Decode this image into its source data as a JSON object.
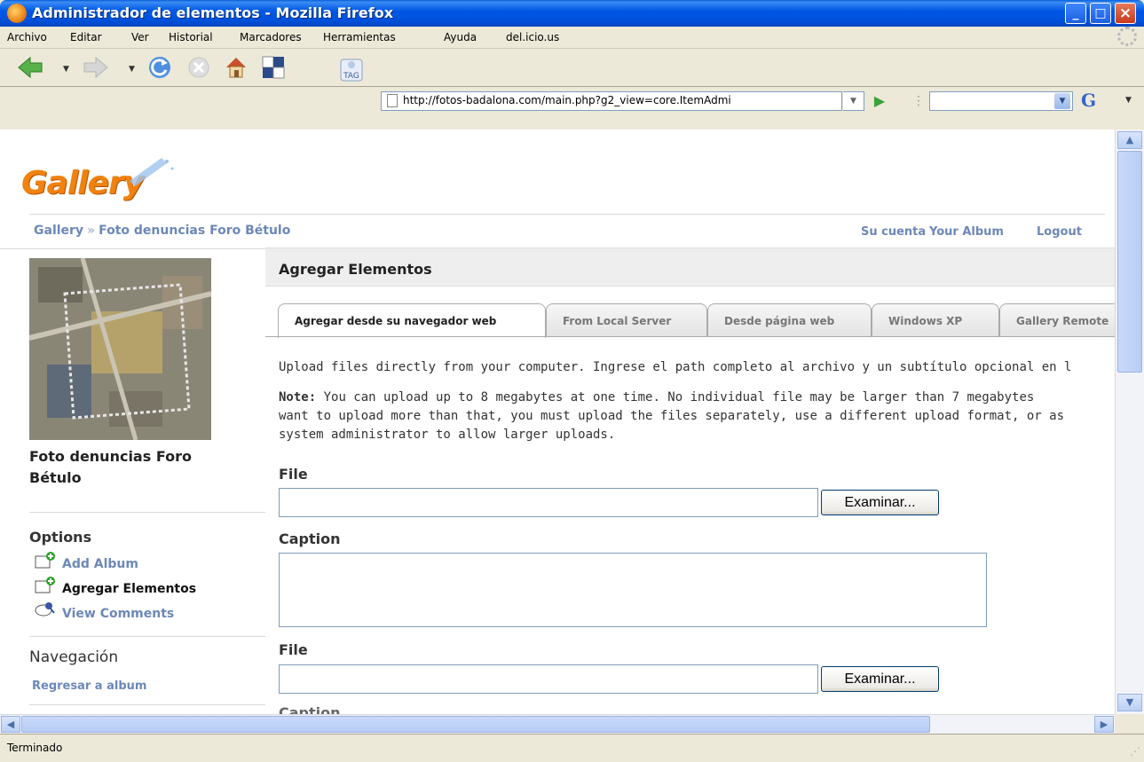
{
  "window": {
    "title": "Administrador de elementos - Mozilla Firefox",
    "controls": [
      "_",
      "□",
      "×"
    ]
  },
  "menubar": {
    "items": [
      "Archivo",
      "Editar",
      "Ver",
      "Historial",
      "Marcadores",
      "Herramientas",
      "Ayuda",
      "del.icio.us"
    ]
  },
  "toolbar": {
    "tag_label": "TAG",
    "url": "http://fotos-badalona.com/main.php?g2_view=core.ItemAdmi",
    "search_engine_label": "G",
    "search_value": ""
  },
  "page": {
    "logo_text": "Gallery",
    "breadcrumb": {
      "root": "Gallery",
      "separator": "»",
      "current": "Foto denuncias Foro Bétulo"
    },
    "top_links": [
      "Su cuenta",
      "Your Album",
      "Logout"
    ],
    "sidebar": {
      "album_title": "Foto denuncias Foro Bétulo",
      "options_heading": "Options",
      "options": [
        "Add Album",
        "Agregar Elementos",
        "View Comments"
      ],
      "navigation_heading": "Navegación",
      "navigation_link": "Regresar a album"
    },
    "main": {
      "title": "Agregar Elementos",
      "tabs": [
        "Agregar desde su navegador web",
        "From Local Server",
        "Desde página web",
        "Windows XP",
        "Gallery Remote"
      ],
      "active_tab": 0,
      "intro": "Upload files directly from your computer. Ingrese el path completo al archivo y un subtítulo opcional en l",
      "note_label": "Note:",
      "note_line1": " You can upload up to 8 megabytes at one time. No individual file may be larger than 7 megabytes",
      "note_line2": "want to upload more than that, you must upload the files separately, use a different upload format, or as",
      "note_line3": "system administrator to allow larger uploads.",
      "file_label": "File",
      "browse_label": "Examinar...",
      "caption_label": "Caption",
      "file_value": "",
      "caption_value": ""
    }
  },
  "status": {
    "text": "Terminado"
  },
  "colors": {
    "titlebar": "#0058e6",
    "link": "#6c88b8",
    "logo": "#f0820f",
    "chrome": "#ece9d8"
  }
}
